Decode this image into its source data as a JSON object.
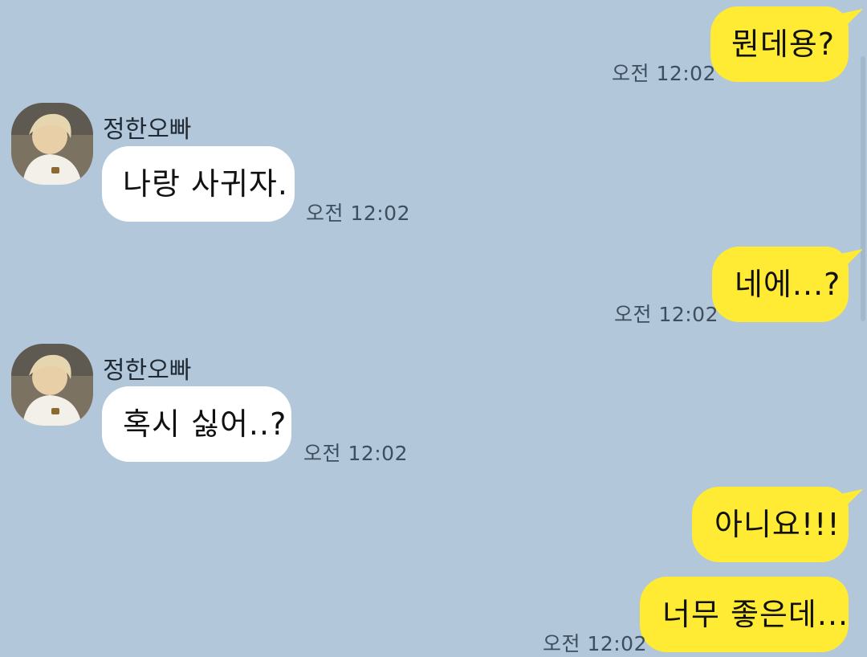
{
  "chat": {
    "messages": [
      {
        "direction": "outgoing",
        "text": "뭔데용?",
        "time": "오전 12:02"
      },
      {
        "direction": "incoming",
        "sender": "정한오빠",
        "text": "나랑 사귀자.",
        "time": "오전 12:02"
      },
      {
        "direction": "outgoing",
        "text": "네에...?",
        "time": "오전 12:02"
      },
      {
        "direction": "incoming",
        "sender": "정한오빠",
        "text": "혹시 싫어..?",
        "time": "오전 12:02"
      },
      {
        "direction": "outgoing",
        "text": "아니요!!!"
      },
      {
        "direction": "outgoing",
        "text": "너무 좋은데...",
        "time": "오전 12:02"
      }
    ]
  },
  "colors": {
    "background": "#b2c7da",
    "outgoing_bubble": "#ffeb33",
    "incoming_bubble": "#ffffff",
    "timestamp": "#3d4e5e"
  }
}
